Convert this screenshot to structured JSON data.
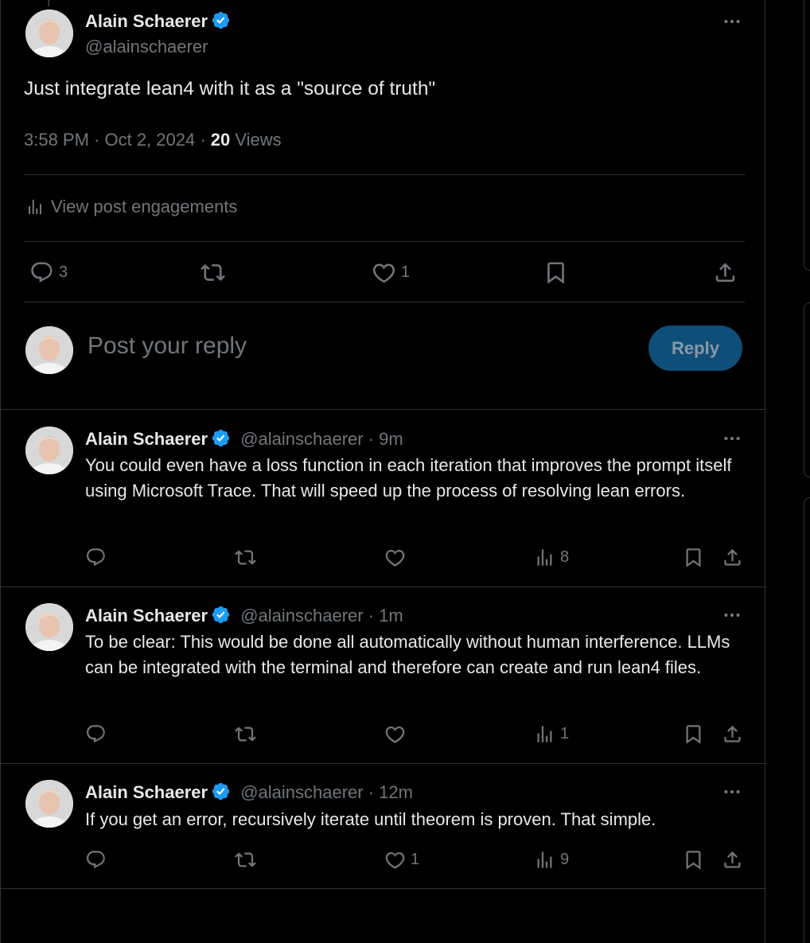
{
  "main_post": {
    "author_name": "Alain Schaerer",
    "author_handle": "@alainschaerer",
    "text": "Just integrate lean4 with it as a \"source of truth\"",
    "time": "3:58 PM · Oct 2, 2024 · ",
    "views_count": "20",
    "views_label": " Views",
    "engagements_label": "View post engagements",
    "actions": {
      "replies": "3",
      "likes": "1"
    }
  },
  "composer": {
    "placeholder": "Post your reply",
    "button_label": "Reply"
  },
  "replies": [
    {
      "author_name": "Alain Schaerer",
      "meta": "@alainschaerer · 9m",
      "text": "You could even have a loss function in each iteration that improves the prompt itself using Microsoft Trace. That will speed up the process of resolving lean errors.",
      "likes": "",
      "views": "8"
    },
    {
      "author_name": "Alain Schaerer",
      "meta": "@alainschaerer · 1m",
      "text": "To be clear: This would be done all automatically without human interference. LLMs can be integrated with the terminal and therefore can create and run lean4 files.",
      "likes": "",
      "views": "1"
    },
    {
      "author_name": "Alain Schaerer",
      "meta": "@alainschaerer · 12m",
      "text": "If you get an error, recursively iterate until theorem is proven. That simple.",
      "likes": "1",
      "views": "9"
    }
  ],
  "colors": {
    "background": "#000000",
    "text_primary": "#e7e9ea",
    "text_secondary": "#71767b",
    "border": "#2f3336",
    "verified_blue": "#1d9bf0",
    "reply_button": "#0f4e78"
  },
  "icons": [
    "verified-badge-icon",
    "more-icon",
    "reply-icon",
    "retweet-icon",
    "like-icon",
    "bookmark-icon",
    "share-icon",
    "analytics-icon"
  ]
}
